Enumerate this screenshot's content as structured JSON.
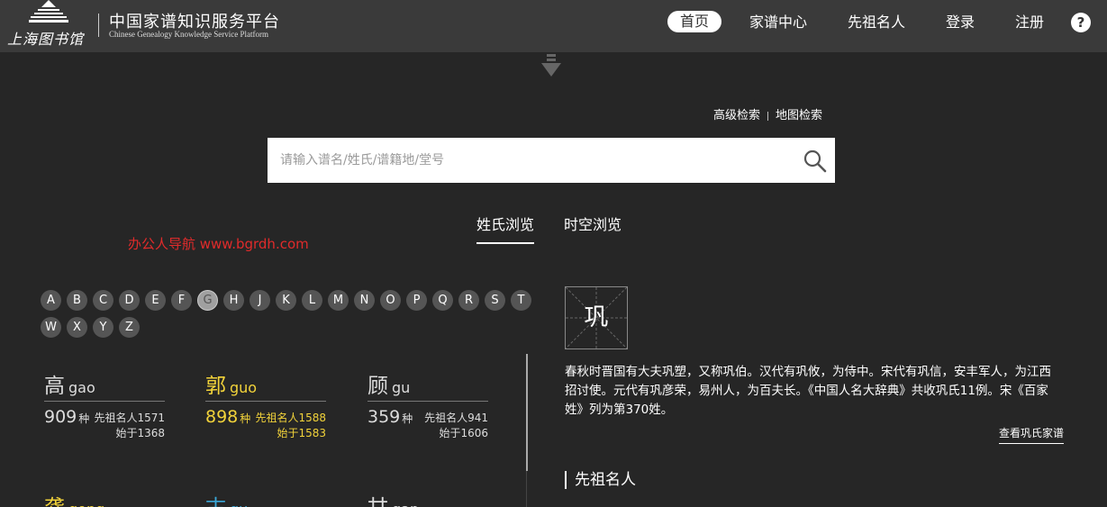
{
  "header": {
    "library_name": "上海图书馆",
    "site_title": "中国家谱知识服务平台",
    "site_subtitle": "Chinese Genealogy Knowledge Service Platform",
    "nav": [
      {
        "label": "首页",
        "active": true
      },
      {
        "label": "家谱中心"
      },
      {
        "label": "先祖名人"
      },
      {
        "label": "登录"
      },
      {
        "label": "注册"
      }
    ],
    "help_label": "?"
  },
  "search": {
    "advanced_label": "高级检索",
    "map_label": "地图检索",
    "placeholder": "请输入谱名/姓氏/谱籍地/堂号"
  },
  "tabs": [
    {
      "label": "姓氏浏览",
      "active": true
    },
    {
      "label": "时空浏览"
    }
  ],
  "watermark": "办公人导航 www.bgrdh.com",
  "letters": [
    "A",
    "B",
    "C",
    "D",
    "E",
    "F",
    "G",
    "H",
    "J",
    "K",
    "L",
    "M",
    "N",
    "O",
    "P",
    "Q",
    "R",
    "S",
    "T",
    "W",
    "X",
    "Y",
    "Z"
  ],
  "active_letter": "G",
  "surnames": [
    {
      "hanzi": "高",
      "pinyin": "gao",
      "count": "909",
      "unit": "种",
      "ancestors": "先祖名人1571",
      "since": "始于1368"
    },
    {
      "hanzi": "郭",
      "pinyin": "guo",
      "count": "898",
      "unit": "种",
      "ancestors": "先祖名人1588",
      "since": "始于1583"
    },
    {
      "hanzi": "顾",
      "pinyin": "gu",
      "count": "359",
      "unit": "种",
      "ancestors": "先祖名人941",
      "since": "始于1606"
    },
    {
      "hanzi": "龚",
      "pinyin": "gong"
    },
    {
      "hanzi": "古",
      "pinyin": "gu"
    },
    {
      "hanzi": "甘",
      "pinyin": "gan"
    }
  ],
  "detail": {
    "character": "巩",
    "description": "春秋时晋国有大夫巩塑，又称巩伯。汉代有巩攸，为侍中。宋代有巩信，安丰军人，为江西招讨使。元代有巩彦荣，易州人，为百夫长。《中国人名大辞典》共收巩氏11例。宋《百家姓》列为第370姓。",
    "view_link": "查看巩氏家谱",
    "section_title": "先祖名人"
  },
  "colors": {
    "background": "#262626",
    "header": "#3a3a3a",
    "yellow": "#f2d33a",
    "blue": "#3aa7d8",
    "watermark": "#e02b2b"
  }
}
